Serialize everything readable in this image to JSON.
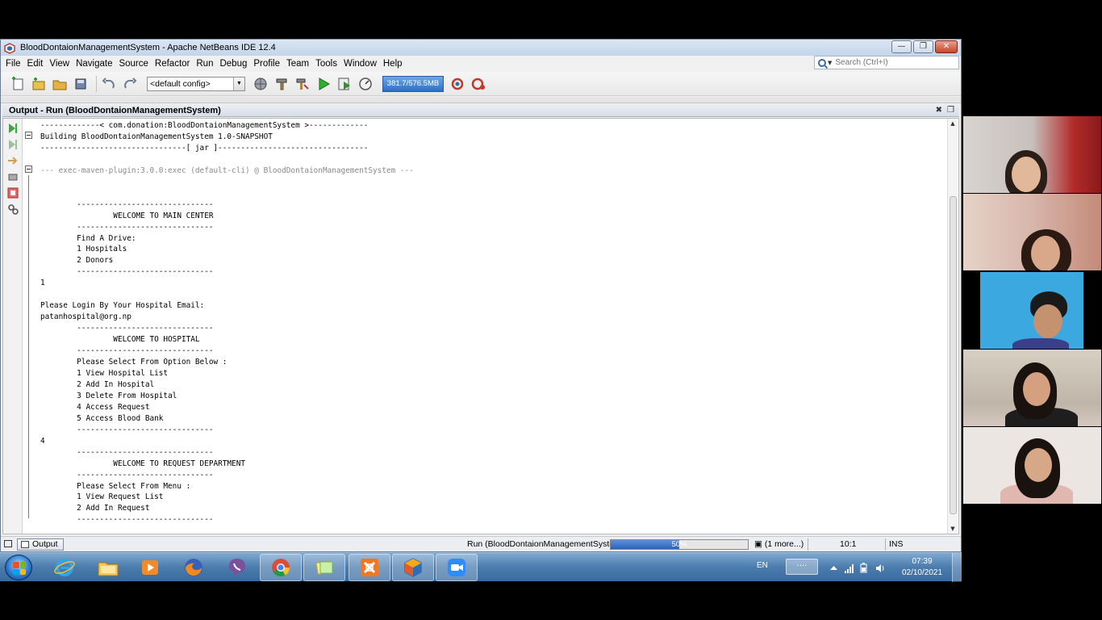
{
  "window": {
    "title": "BloodDontaionManagementSystem - Apache NetBeans IDE 12.4",
    "min_label": "—",
    "max_label": "❐",
    "close_label": "✕"
  },
  "menu": [
    "File",
    "Edit",
    "View",
    "Navigate",
    "Source",
    "Refactor",
    "Run",
    "Debug",
    "Profile",
    "Team",
    "Tools",
    "Window",
    "Help"
  ],
  "search": {
    "placeholder": "Search (Ctrl+I)"
  },
  "toolbar": {
    "config": "<default config>",
    "memory": "381.7/576.5MB"
  },
  "output": {
    "title": "Output - Run (BloodDontaionManagementSystem)",
    "lines": [
      "-------------< com.donation:BloodDontaionManagementSystem >-------------",
      "Building BloodDontaionManagementSystem 1.0-SNAPSHOT",
      "--------------------------------[ jar ]---------------------------------",
      "",
      "--- exec-maven-plugin:3.0.0:exec (default-cli) @ BloodDontaionManagementSystem ---",
      "",
      "",
      "        ------------------------------",
      "                WELCOME TO MAIN CENTER",
      "        ------------------------------",
      "        Find A Drive:",
      "        1 Hospitals",
      "        2 Donors",
      "        ------------------------------",
      "1",
      "",
      "Please Login By Your Hospital Email:",
      "patanhospital@org.np",
      "        ------------------------------",
      "                WELCOME TO HOSPITAL",
      "        ------------------------------",
      "        Please Select From Option Below :",
      "        1 View Hospital List",
      "        2 Add In Hospital",
      "        3 Delete From Hospital",
      "        4 Access Request",
      "        5 Access Blood Bank",
      "        ------------------------------",
      "4",
      "        ------------------------------",
      "                WELCOME TO REQUEST DEPARTMENT",
      "        ------------------------------",
      "        Please Select From Menu :",
      "        1 View Request List",
      "        2 Add In Request",
      "        ------------------------------"
    ]
  },
  "statusbar": {
    "tab_label": "Output",
    "run_label": "Run (BloodDontaionManagementSystem)",
    "progress_percent": 50,
    "progress_text": "50%",
    "more": "(1 more...)",
    "position": "10:1",
    "mode": "INS"
  },
  "taskbar": {
    "lang": "EN",
    "tray_box": "····",
    "time": "07:39",
    "date": "02/10/2021"
  },
  "colors": {
    "accent": "#2c63b8",
    "titlebar": "#c4d5ea",
    "taskbar": "#4b7cad"
  }
}
